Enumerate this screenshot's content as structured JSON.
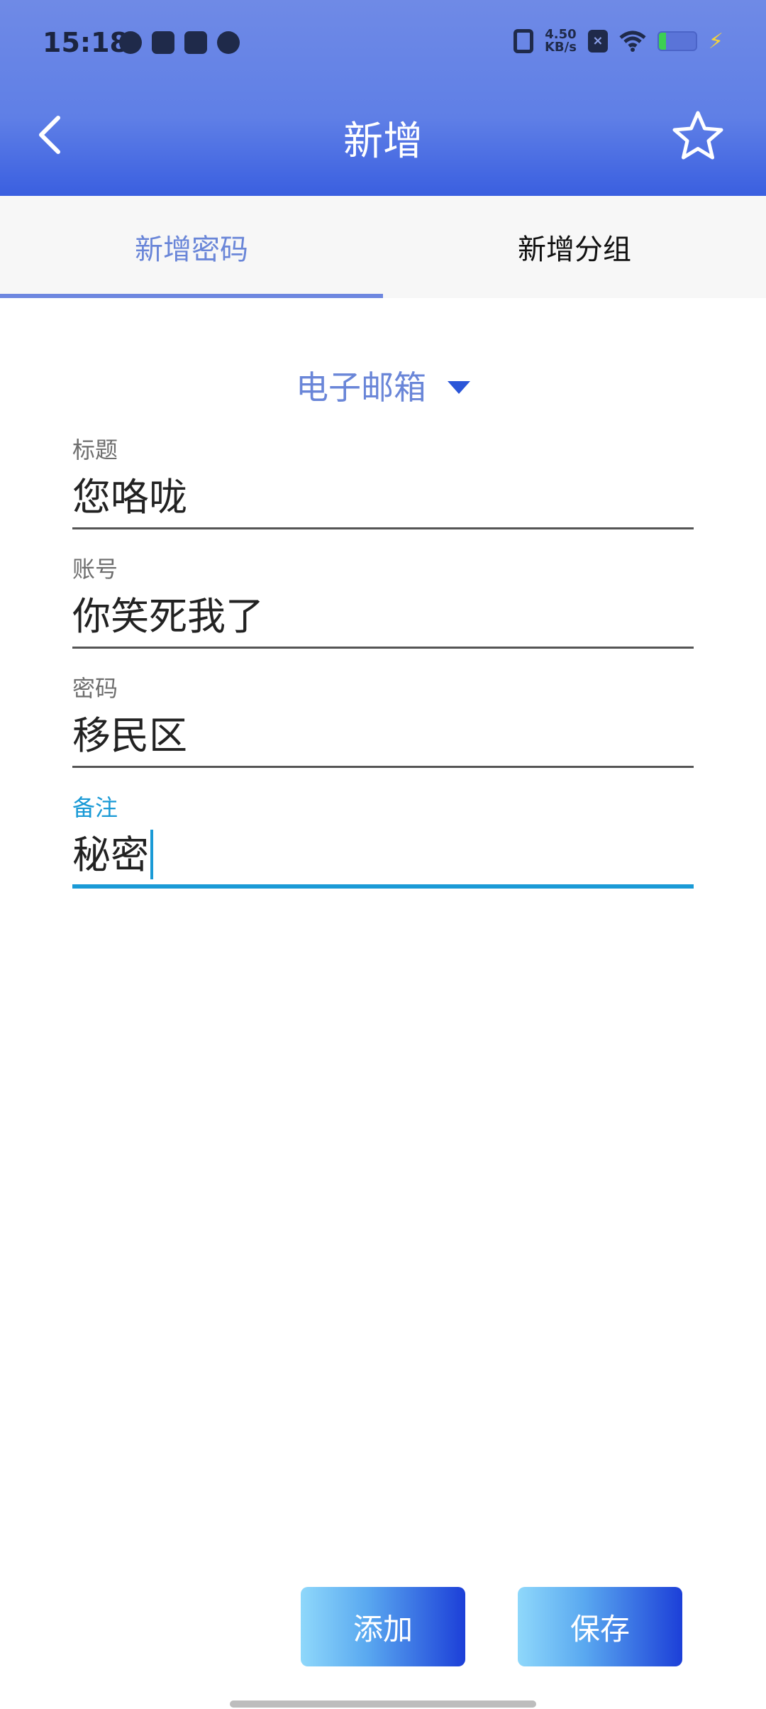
{
  "status_bar": {
    "time": "15:18",
    "net_speed_value": "4.50",
    "net_speed_unit": "KB/s",
    "sim_icon_label": "×"
  },
  "header": {
    "title": "新增",
    "back_icon": "chevron-left-icon",
    "star_icon": "star-outline-icon"
  },
  "tabs": [
    {
      "label": "新增密码",
      "active": true
    },
    {
      "label": "新增分组",
      "active": false
    }
  ],
  "category": {
    "selected": "电子邮箱"
  },
  "form": {
    "title_label": "标题",
    "title_value": "您咯咙",
    "account_label": "账号",
    "account_value": "你笑死我了",
    "password_label": "密码",
    "password_value": "移民区",
    "note_label": "备注",
    "note_value": "秘密"
  },
  "buttons": {
    "add_label": "添加",
    "save_label": "保存"
  },
  "colors": {
    "accent": "#6a86d8",
    "focus": "#1a9ad6",
    "header_top": "#6f8ae6",
    "header_bottom": "#3a5fe0"
  }
}
